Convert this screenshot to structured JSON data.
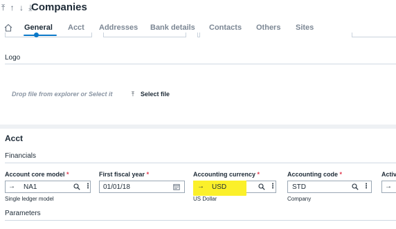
{
  "header": {
    "nav_arrows": "⤒ ↑ ↓ ⤓",
    "title": "Companies"
  },
  "tabs": [
    {
      "label": "General",
      "active": true
    },
    {
      "label": "Acct",
      "active": false
    },
    {
      "label": "Addresses",
      "active": false
    },
    {
      "label": "Bank details",
      "active": false
    },
    {
      "label": "Contacts",
      "active": false
    },
    {
      "label": "Others",
      "active": false
    },
    {
      "label": "Sites",
      "active": false
    }
  ],
  "logo_section": {
    "label": "Logo",
    "drop_text": "Drop file from explorer or Select it",
    "select_file_label": "Select file"
  },
  "acct_section": {
    "title": "Acct",
    "financials_label": "Financials",
    "fields": [
      {
        "label": "Account core model",
        "required": "*",
        "value": "NA1",
        "helper": "Single ledger model"
      },
      {
        "label": "First fiscal year",
        "required": "*",
        "value": "01/01/18",
        "helper": ""
      },
      {
        "label": "Accounting currency",
        "required": "*",
        "value": "USD",
        "helper": "US Dollar"
      },
      {
        "label": "Accounting code",
        "required": "*",
        "value": "STD",
        "helper": "Company"
      },
      {
        "label": "Activ",
        "required": "",
        "value": "",
        "helper": ""
      }
    ],
    "parameters_label": "Parameters"
  },
  "colors": {
    "accent": "#0a78c8",
    "highlight": "#fbf02a",
    "required": "#e0354b"
  },
  "icons": {
    "home": "home-icon",
    "upload": "upload-icon",
    "search": "search-icon",
    "more": "kebab-icon",
    "calendar": "calendar-icon",
    "arrow": "arrow-right-icon"
  }
}
